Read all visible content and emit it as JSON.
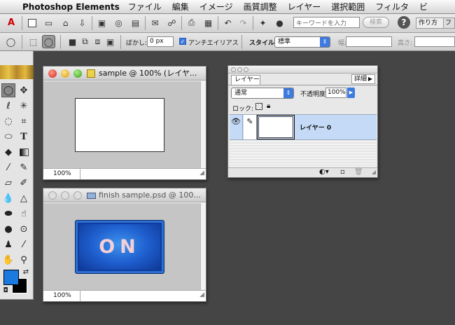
{
  "menubar": {
    "app_name": "Photoshop Elements",
    "items": [
      "ファイル",
      "編集",
      "イメージ",
      "画質調整",
      "レイヤー",
      "選択範囲",
      "フィルタ",
      "ビ"
    ]
  },
  "toolbar": {
    "search_placeholder": "キーワードを入力",
    "search_button": "検索",
    "help_icon": "?",
    "how_to_tab": "作り方",
    "partial_tab": "フ"
  },
  "options_bar": {
    "feather_label": "ぼかし:",
    "feather_value": "0 px",
    "antialias_label": "アンチエイリアス",
    "antialias_checked": true,
    "style_label": "スタイル:",
    "style_value": "標準",
    "width_label": "幅:",
    "height_label": "高さ:"
  },
  "windows": {
    "sample": {
      "title": "sample @ 100% (レイヤ...",
      "zoom": "100%"
    },
    "finish": {
      "title": "finish sample.psd @ 100...",
      "zoom": "100%",
      "button_text": "ON"
    }
  },
  "layers_panel": {
    "tab": "レイヤー",
    "details_button": "詳細",
    "blend_mode": "通常",
    "opacity_label": "不透明度:",
    "opacity_value": "100%",
    "lock_label": "ロック:",
    "layer_name": "レイヤー 0"
  },
  "colors": {
    "foreground": "#1a7ae0",
    "background": "#000000",
    "desktop": "#454545",
    "selected_layer": "#c4daf6"
  }
}
